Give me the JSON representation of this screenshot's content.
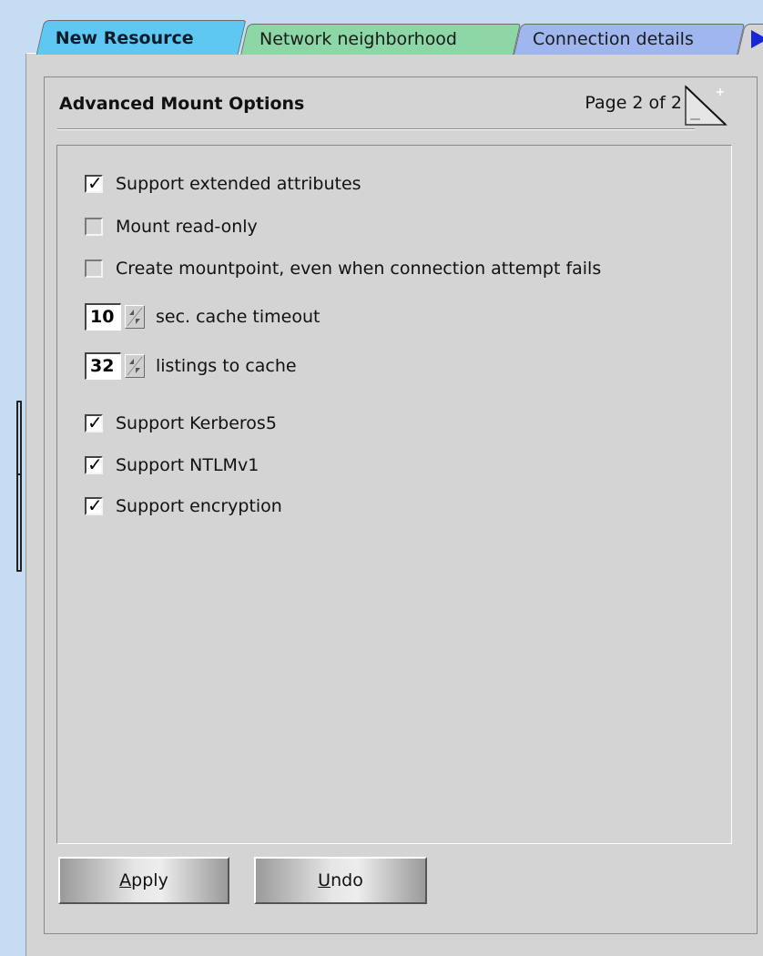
{
  "tabs": [
    {
      "label": "New Resource",
      "active": true,
      "color": "#5fc8f2"
    },
    {
      "label": "Network neighborhood",
      "active": false,
      "color": "#8dd7a6"
    },
    {
      "label": "Connection details",
      "active": false,
      "color": "#9fb7ee"
    }
  ],
  "tab_overflow_icon": "right-arrow-icon",
  "panel": {
    "title": "Advanced Mount Options",
    "page_indicator": "Page 2 of 2",
    "page_icon": "page-corner-icon"
  },
  "options": {
    "extended_attributes": {
      "label": "Support extended attributes",
      "checked": true
    },
    "read_only": {
      "label": "Mount read-only",
      "checked": false
    },
    "create_mountpoint": {
      "label": "Create mountpoint, even when connection attempt fails",
      "checked": false
    },
    "cache_timeout": {
      "value": "10",
      "label": "sec. cache timeout"
    },
    "listings": {
      "value": "32",
      "label": "listings to cache"
    },
    "kerberos": {
      "label": "Support Kerberos5",
      "checked": true
    },
    "ntlm": {
      "label": "Support NTLMv1",
      "checked": true
    },
    "encryption": {
      "label": "Support encryption",
      "checked": true
    }
  },
  "buttons": {
    "apply_mnemonic": "A",
    "apply_rest": "pply",
    "undo_mnemonic": "U",
    "undo_rest": "ndo"
  },
  "check_mark": "✓"
}
